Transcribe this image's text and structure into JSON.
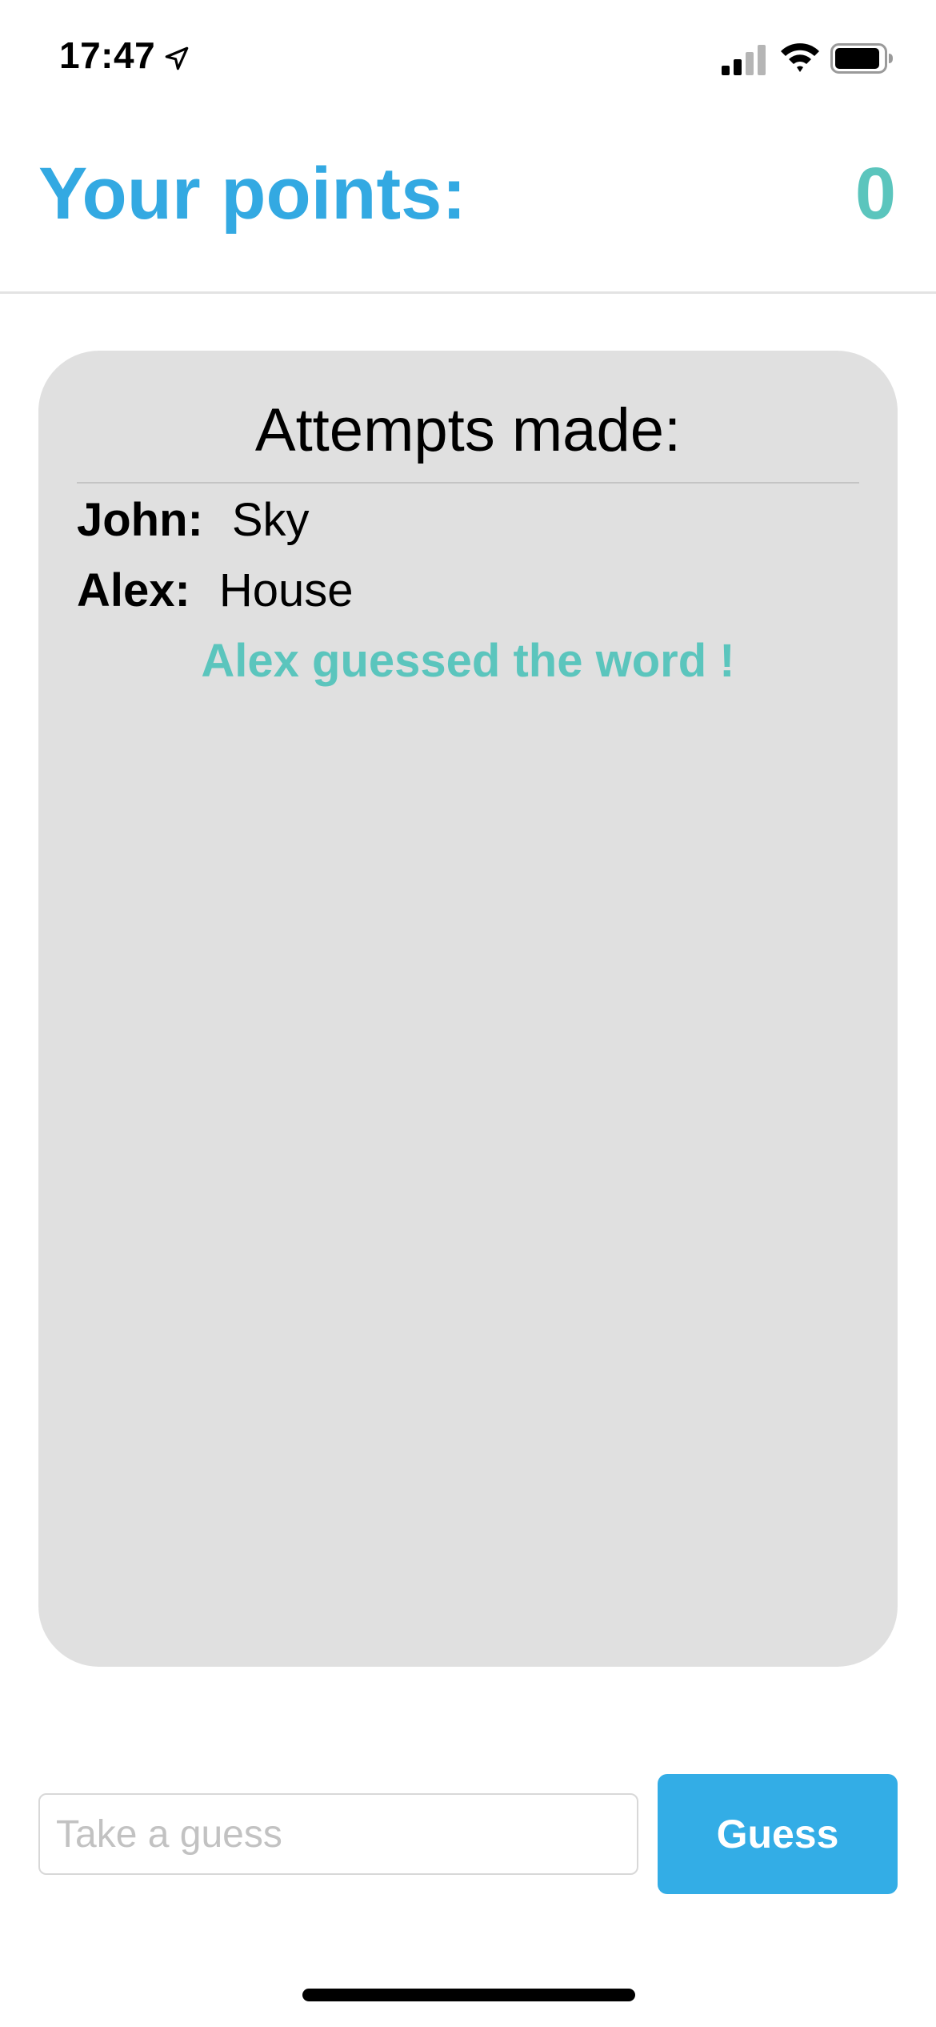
{
  "status_bar": {
    "time": "17:47",
    "icons": [
      "location-arrow-icon",
      "cellular-signal-icon",
      "wifi-icon",
      "battery-icon"
    ]
  },
  "header": {
    "points_label": "Your points:",
    "points_value": "0"
  },
  "attempts": {
    "title": "Attempts made:",
    "items": [
      {
        "name": "John:",
        "word": "Sky"
      },
      {
        "name": "Alex:",
        "word": "House"
      }
    ],
    "result_message": "Alex guessed the word !"
  },
  "guess": {
    "input_value": "",
    "input_placeholder": "Take a guess",
    "button_label": "Guess"
  },
  "colors": {
    "accent_blue": "#33a9e2",
    "accent_teal": "#5bc5bd",
    "card_background": "#e0e0e0"
  }
}
